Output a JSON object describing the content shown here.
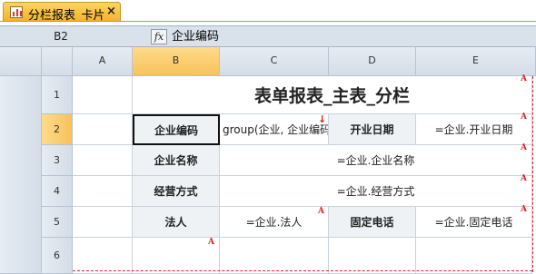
{
  "tab": {
    "title": "分栏报表_卡片",
    "close": "×"
  },
  "formula_bar": {
    "cell_ref": "B2",
    "fx": "fx",
    "value": "企业编码"
  },
  "columns": [
    "",
    "A",
    "B",
    "C",
    "D",
    "E"
  ],
  "rows": [
    "1",
    "2",
    "3",
    "4",
    "5",
    "6"
  ],
  "cells": {
    "title": "表单报表_主表_分栏",
    "r2": {
      "b": "企业编码",
      "c": "group(企业, 企业编码",
      "d": "开业日期",
      "e": "=企业.开业日期"
    },
    "r3": {
      "b": "企业名称",
      "cde": "=企业.企业名称"
    },
    "r4": {
      "b": "经营方式",
      "cde": "=企业.经营方式"
    },
    "r5": {
      "b": "法人",
      "c": "=企业.法人",
      "d": "固定电话",
      "e": "=企业.固定电话"
    }
  },
  "markers": {
    "a": "A",
    "arrow": "↓"
  },
  "colors": {
    "selected_header": "#f7c25b",
    "label_bg": "#eef2f4",
    "marker": "#dd2222",
    "tab": "#f4b02f"
  }
}
